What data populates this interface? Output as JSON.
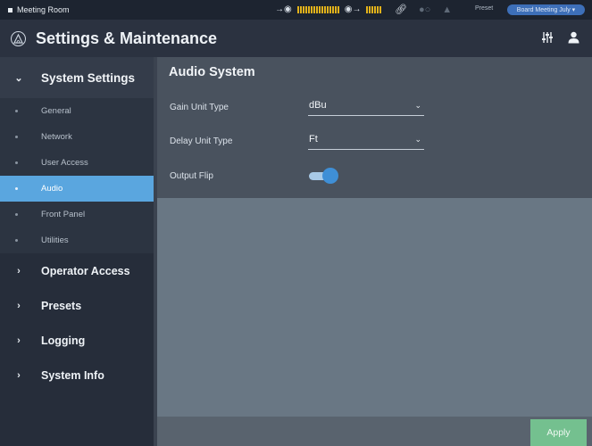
{
  "status_bar": {
    "room_name": "Meeting Room",
    "preset_label": "Preset",
    "preset_value": "Board Meeting July ▾"
  },
  "header": {
    "title": "Settings & Maintenance",
    "icons": [
      "logo-icon",
      "mixer-sliders-icon",
      "user-icon"
    ]
  },
  "sidebar": {
    "expanded_section": "System Settings",
    "sub_items": [
      {
        "label": "General",
        "active": false
      },
      {
        "label": "Network",
        "active": false
      },
      {
        "label": "User Access",
        "active": false
      },
      {
        "label": "Audio",
        "active": true
      },
      {
        "label": "Front Panel",
        "active": false
      },
      {
        "label": "Utilities",
        "active": false
      }
    ],
    "sections": [
      "Operator Access",
      "Presets",
      "Logging",
      "System Info"
    ]
  },
  "main": {
    "title": "Audio System",
    "gain_unit": {
      "label": "Gain Unit Type",
      "value": "dBu"
    },
    "delay_unit": {
      "label": "Delay Unit Type",
      "value": "Ft"
    },
    "output_flip": {
      "label": "Output Flip",
      "on": true
    },
    "apply_label": "Apply"
  },
  "colors": {
    "accent": "#5aa6df",
    "toggle_on": "#3f8fd6",
    "apply": "#74c08f",
    "meter": "#e2b21b"
  }
}
